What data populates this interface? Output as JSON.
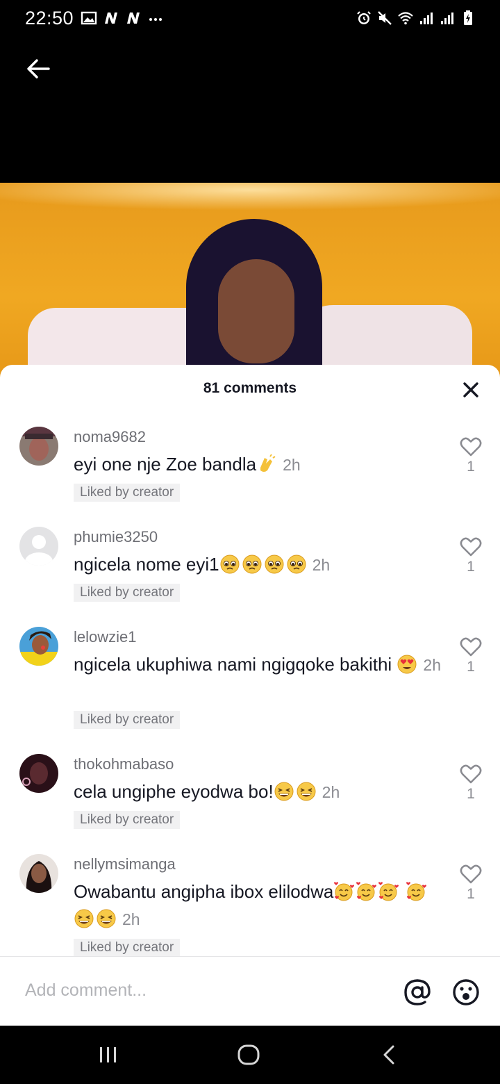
{
  "status_bar": {
    "time": "22:50",
    "left_icons": [
      "image-icon",
      "n-icon",
      "n-icon",
      "more-icon"
    ],
    "right_icons": [
      "alarm-icon",
      "mute-icon",
      "wifi-icon",
      "signal-icon",
      "signal-icon",
      "battery-icon"
    ]
  },
  "comments_sheet": {
    "title": "81 comments",
    "comments": [
      {
        "username": "noma9682",
        "text": "eyi one nje Zoe bandla",
        "emojis": [
          "clap"
        ],
        "time": "2h",
        "badge": "Liked by creator",
        "likes": "1"
      },
      {
        "username": "phumie3250",
        "text": "ngicela nome eyi1",
        "emojis": [
          "pleading",
          "pleading",
          "pleading",
          "pleading"
        ],
        "time": "2h",
        "badge": "Liked by creator",
        "likes": "1"
      },
      {
        "username": "lelowzie1",
        "text": "ngicela ukuphiwa nami ngigqoke bakithi",
        "emojis": [
          "heart-eyes"
        ],
        "time": "2h",
        "badge": "Liked by creator",
        "likes": "1"
      },
      {
        "username": "thokohmabaso",
        "text": "cela ungiphe eyodwa bo!",
        "emojis": [
          "laughing",
          "laughing"
        ],
        "time": "2h",
        "badge": "Liked by creator",
        "likes": "1"
      },
      {
        "username": "nellymsimanga",
        "text": "Owabantu angipha ibox elilodwa",
        "emojis": [
          "smiling-hearts",
          "smiling-hearts",
          "smiling-hearts",
          "smiling-hearts",
          "laughing",
          "laughing"
        ],
        "time": "2h",
        "badge": "Liked by creator",
        "likes": "1"
      }
    ]
  },
  "input_bar": {
    "placeholder": "Add comment..."
  },
  "colors": {
    "sheet_bg": "#ffffff",
    "text_primary": "#161823",
    "text_secondary": "#8a8b91",
    "badge_bg": "#f1f1f2",
    "video_bg": "#f0a822"
  }
}
